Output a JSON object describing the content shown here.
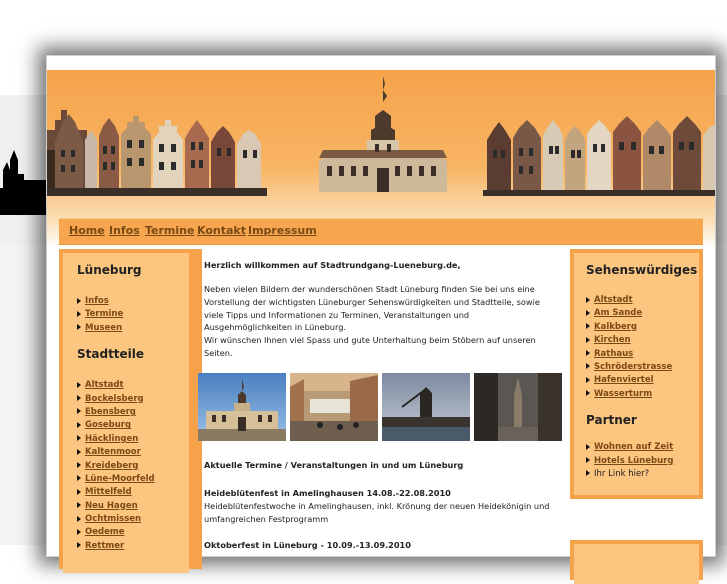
{
  "nav": {
    "items": [
      {
        "label": "Home"
      },
      {
        "label": "Infos"
      },
      {
        "label": "Termine"
      },
      {
        "label": "Kontakt"
      },
      {
        "label": "Impressum"
      }
    ]
  },
  "left": {
    "heading1": "Lüneburg",
    "links1": [
      "Infos",
      "Termine",
      "Museen"
    ],
    "heading2": "Stadtteile",
    "links2": [
      "Altstadt",
      "Bockelsberg",
      "Ebensberg",
      "Goseburg",
      "Häcklingen",
      "Kaltenmoor",
      "Kreideberg",
      "Lüne-Moorfeld",
      "Mittelfeld",
      "Neu Hagen",
      "Ochtmissen",
      "Oedeme",
      "Rettmer"
    ]
  },
  "right": {
    "heading1": "Sehenswürdiges",
    "links1": [
      "Altstadt",
      "Am Sande",
      "Kalkberg",
      "Kirchen",
      "Rathaus",
      "Schröderstrasse",
      "Hafenviertel",
      "Wasserturm"
    ],
    "heading2": "Partner",
    "links2": [
      "Wohnen auf Zeit",
      "Hotels Lüneburg"
    ],
    "plain2": "Ihr Link hier?"
  },
  "content": {
    "welcome": "Herzlich willkommen auf Stadtrundgang-Lueneburg.de,",
    "intro_lines": [
      "Neben vielen Bildern der wunderschönen Stadt Lüneburg finden Sie bei uns eine",
      "Vorstellung der wichtigsten Lüneburger Sehenswürdigkeiten und Stadtteile, sowie",
      "viele Tipps und Informationen zu Terminen, Veranstaltungen und",
      "Ausgehmöglichkeiten in Lüneburg.",
      "Wir wünschen Ihnen viel Spass und gute Unterhaltung beim Stöbern auf unseren",
      "Seiten."
    ],
    "events_heading": "Aktuelle Termine / Veranstaltungen in und um Lüneburg",
    "event1_title": "Heideblütenfest in Amelinghausen 14.08.-22.08.2010",
    "event1_lines": [
      "Heideblütenfestwoche in Amelinghausen, inkl. Krönung der neuen Heidekönigin und",
      "umfangreichen Festprogramm"
    ],
    "event2_title": "Oktoberfest in Lüneburg - 10.09.-13.09.2010"
  },
  "colors": {
    "orange": "#f6a24a",
    "light_orange": "#fcc681",
    "link": "#7a4a14"
  }
}
